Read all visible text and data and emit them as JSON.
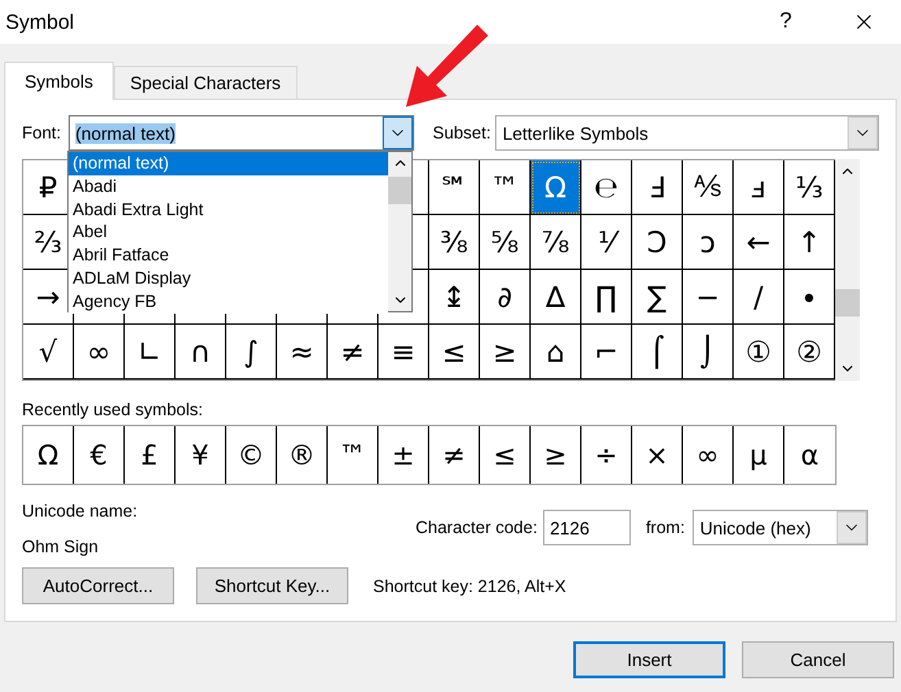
{
  "window": {
    "title": "Symbol",
    "help": "?"
  },
  "tabs": [
    {
      "label": "Symbols",
      "selected": true
    },
    {
      "label": "Special Characters",
      "selected": false
    }
  ],
  "font": {
    "label": "Font:",
    "value": "(normal text)",
    "expanded": true,
    "options": [
      {
        "label": "(normal text)",
        "selected": true
      },
      {
        "label": "Abadi",
        "selected": false
      },
      {
        "label": "Abadi Extra Light",
        "selected": false
      },
      {
        "label": "Abel",
        "selected": false
      },
      {
        "label": "Abril Fatface",
        "selected": false
      },
      {
        "label": "ADLaM Display",
        "selected": false
      },
      {
        "label": "Agency FB",
        "selected": false
      }
    ]
  },
  "subset": {
    "label": "Subset:",
    "value": "Letterlike Symbols"
  },
  "grid": {
    "rows": [
      [
        {
          "symbol": "₽",
          "selected": false
        },
        null,
        null,
        null,
        null,
        null,
        null,
        null,
        {
          "symbol": "℠",
          "selected": false
        },
        {
          "symbol": "™",
          "selected": false
        },
        {
          "symbol": "Ω",
          "selected": true
        },
        {
          "symbol": "℮",
          "selected": false
        },
        {
          "symbol": "Ⅎ",
          "selected": false
        },
        {
          "symbol": "⅍",
          "selected": false
        },
        {
          "symbol": "ⅎ",
          "selected": false
        },
        {
          "symbol": "⅓",
          "selected": false
        }
      ],
      [
        {
          "symbol": "⅔",
          "selected": false
        },
        null,
        null,
        null,
        null,
        null,
        null,
        null,
        {
          "symbol": "⅜",
          "selected": false
        },
        {
          "symbol": "⅝",
          "selected": false
        },
        {
          "symbol": "⅞",
          "selected": false
        },
        {
          "symbol": "⅟",
          "selected": false
        },
        {
          "symbol": "Ↄ",
          "selected": false
        },
        {
          "symbol": "ↄ",
          "selected": false
        },
        {
          "symbol": "←",
          "selected": false
        },
        {
          "symbol": "↑",
          "selected": false
        }
      ],
      [
        {
          "symbol": "→",
          "selected": false
        },
        null,
        null,
        null,
        null,
        null,
        null,
        null,
        {
          "symbol": "↨",
          "selected": false
        },
        {
          "symbol": "∂",
          "selected": false
        },
        {
          "symbol": "∆",
          "selected": false
        },
        {
          "symbol": "∏",
          "selected": false
        },
        {
          "symbol": "∑",
          "selected": false
        },
        {
          "symbol": "−",
          "selected": false
        },
        {
          "symbol": "∕",
          "selected": false
        },
        {
          "symbol": "∙",
          "selected": false
        }
      ],
      [
        {
          "symbol": "√",
          "selected": false
        },
        {
          "symbol": "∞",
          "selected": false
        },
        {
          "symbol": "∟",
          "selected": false
        },
        {
          "symbol": "∩",
          "selected": false
        },
        {
          "symbol": "∫",
          "selected": false
        },
        {
          "symbol": "≈",
          "selected": false
        },
        {
          "symbol": "≠",
          "selected": false
        },
        {
          "symbol": "≡",
          "selected": false
        },
        {
          "symbol": "≤",
          "selected": false
        },
        {
          "symbol": "≥",
          "selected": false
        },
        {
          "symbol": "⌂",
          "selected": false
        },
        {
          "symbol": "⌐",
          "selected": false
        },
        {
          "symbol": "⌠",
          "selected": false
        },
        {
          "symbol": "⌡",
          "selected": false
        },
        {
          "symbol": "①",
          "selected": false
        },
        {
          "symbol": "②",
          "selected": false
        }
      ]
    ]
  },
  "recent": {
    "label": "Recently used symbols:",
    "symbols": [
      "Ω",
      "€",
      "£",
      "¥",
      "©",
      "®",
      "™",
      "±",
      "≠",
      "≤",
      "≥",
      "÷",
      "×",
      "∞",
      "µ",
      "α"
    ]
  },
  "unicode_name": {
    "label": "Unicode name:",
    "value": "Ohm Sign"
  },
  "character_code": {
    "label": "Character code:",
    "value": "2126"
  },
  "from": {
    "label": "from:",
    "value": "Unicode (hex)"
  },
  "autocorrect_button": {
    "label": "AutoCorrect..."
  },
  "shortcut_button": {
    "label": "Shortcut Key..."
  },
  "shortcut_text": "Shortcut key: 2126, Alt+X",
  "buttons": [
    {
      "label": "Insert",
      "default": true
    },
    {
      "label": "Cancel",
      "default": false
    }
  ]
}
